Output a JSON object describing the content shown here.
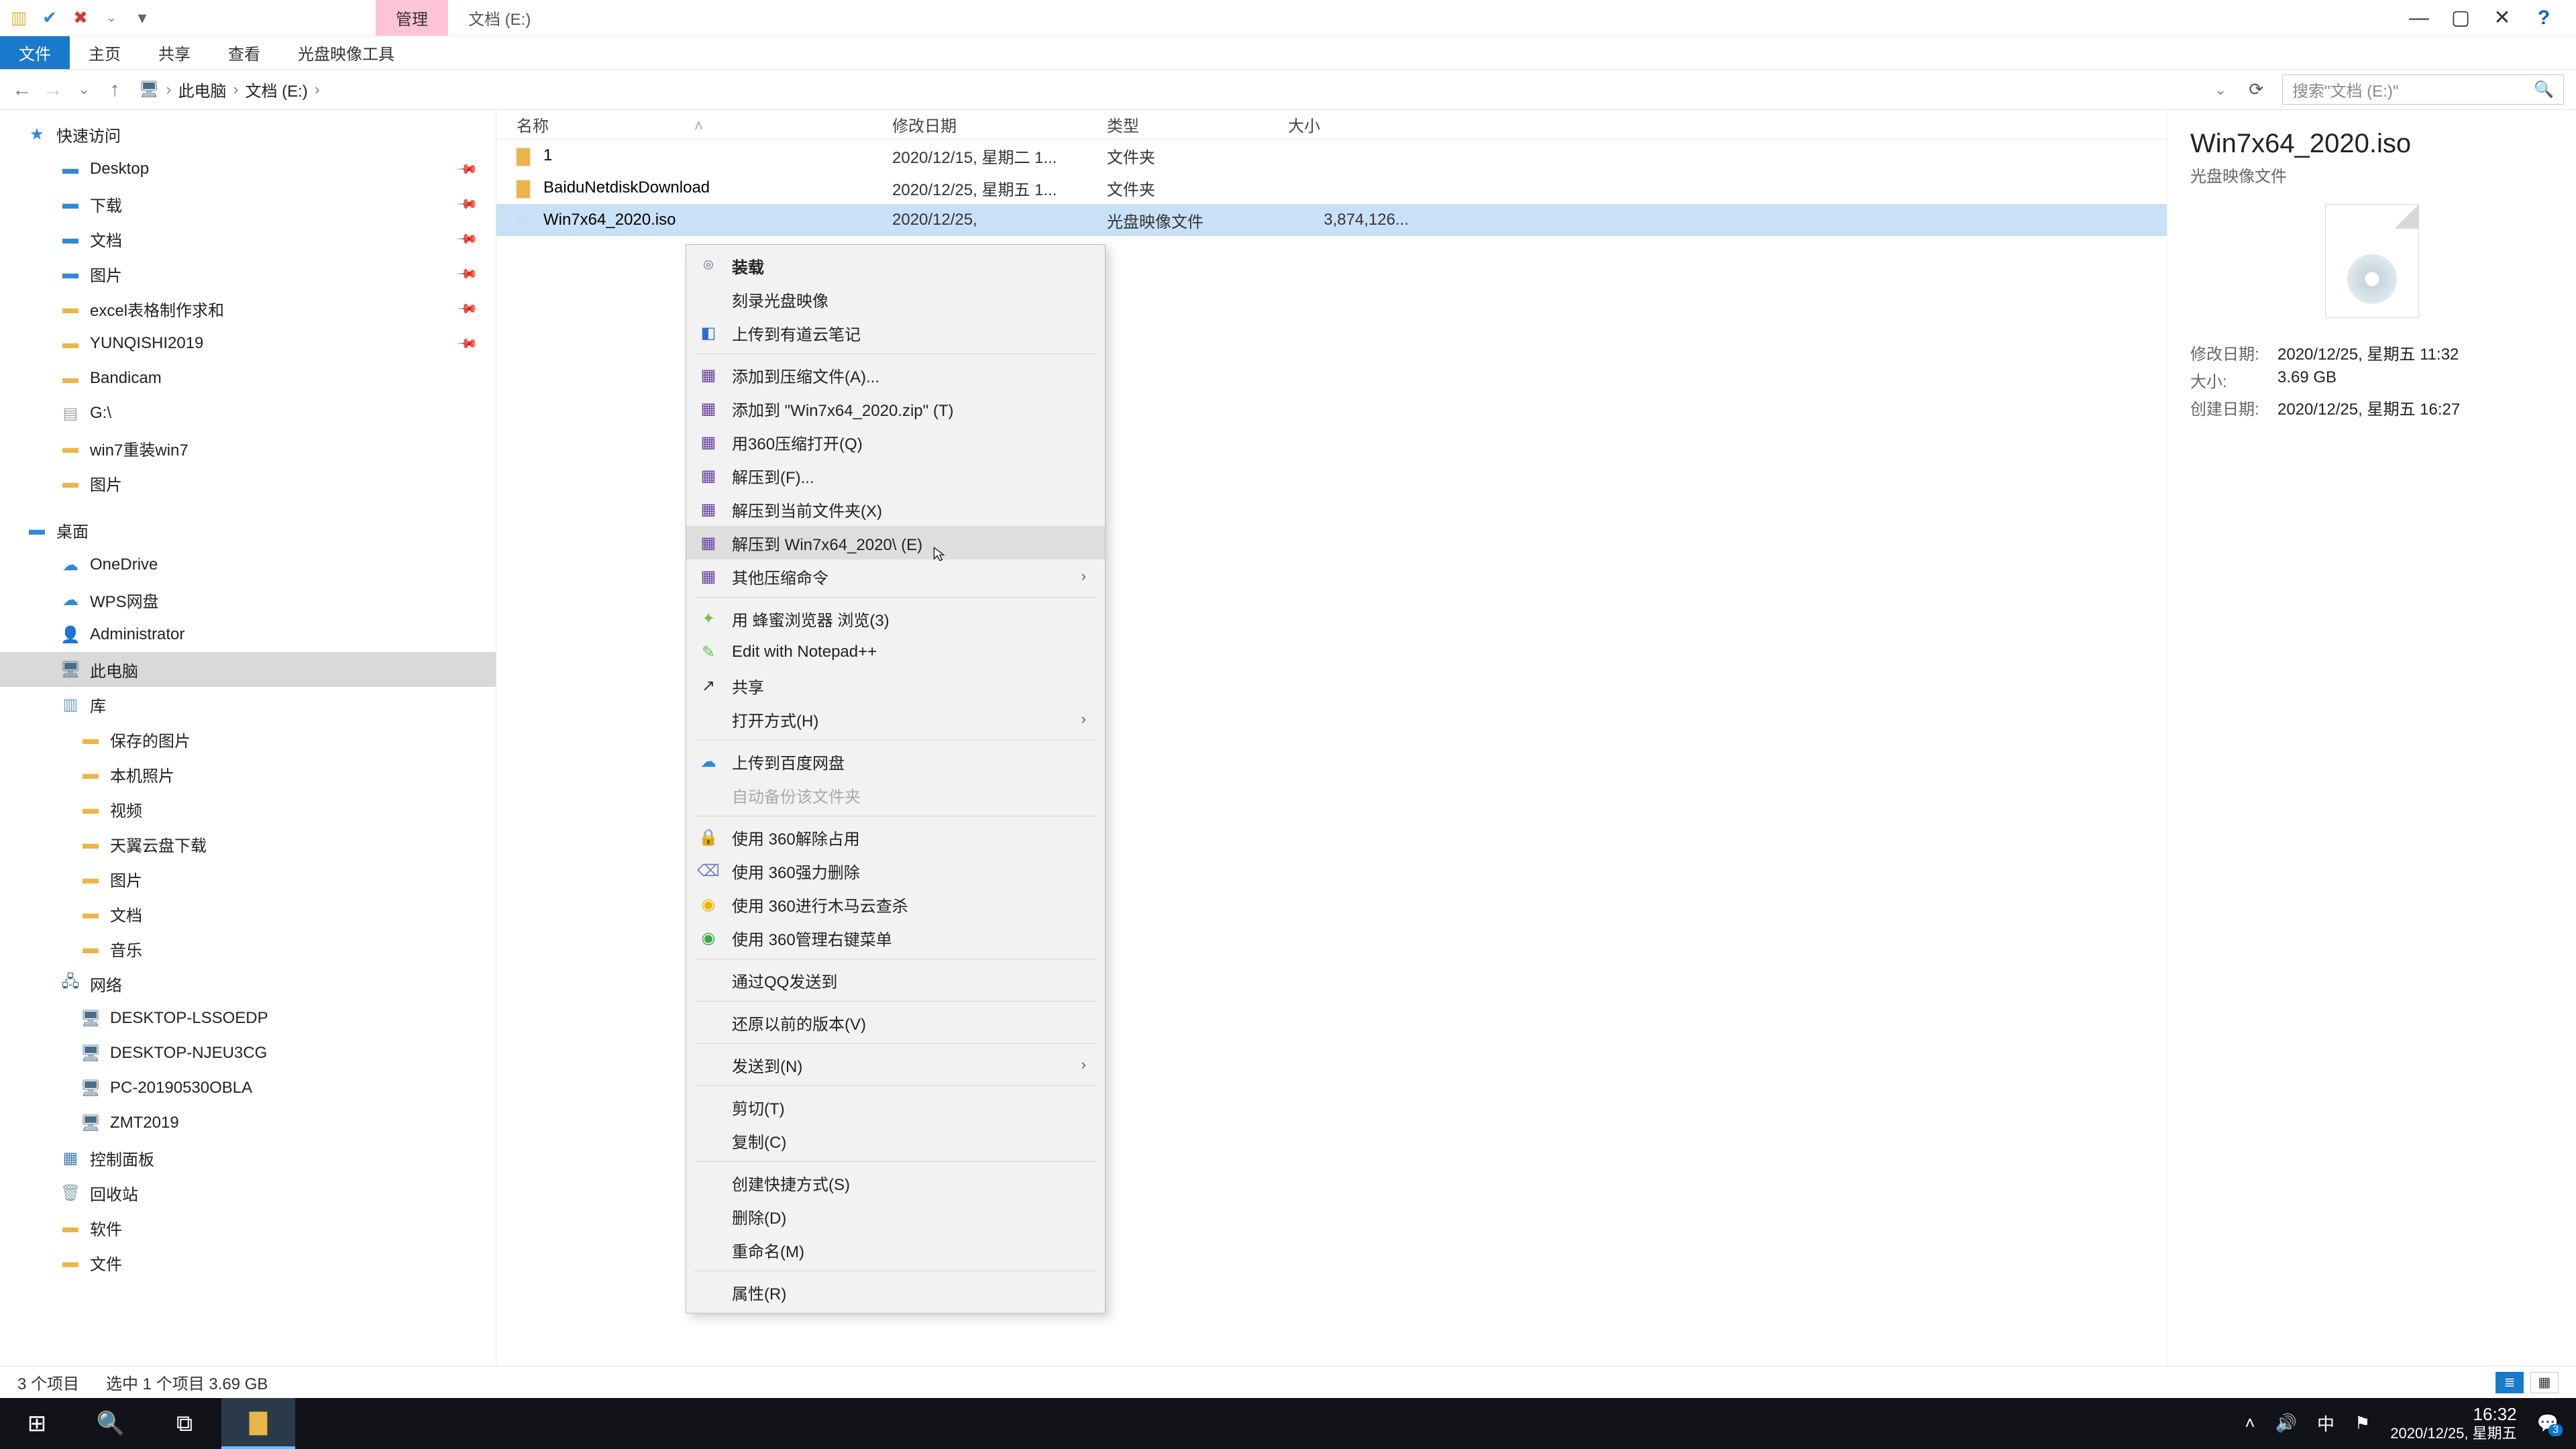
{
  "window": {
    "tab_manage": "管理",
    "tab_title": "文档 (E:)"
  },
  "ribbon": {
    "file": "文件",
    "home": "主页",
    "share": "共享",
    "view": "查看",
    "iso": "光盘映像工具"
  },
  "breadcrumb": {
    "pc": "此电脑",
    "loc": "文档 (E:)"
  },
  "search": {
    "placeholder": "搜索\"文档 (E:)\""
  },
  "columns": {
    "name": "名称",
    "date": "修改日期",
    "type": "类型",
    "size": "大小"
  },
  "tree": {
    "quick": "快速访问",
    "desktop": "Desktop",
    "downloads": "下载",
    "documents": "文档",
    "pictures": "图片",
    "excel": "excel表格制作求和",
    "yunqishi": "YUNQISHI2019",
    "bandicam": "Bandicam",
    "gdrive": "G:\\",
    "win7reinstall": "win7重装win7",
    "pictures2": "图片",
    "desk_top": "桌面",
    "onedrive": "OneDrive",
    "wps": "WPS网盘",
    "admin": "Administrator",
    "thispc": "此电脑",
    "libraries": "库",
    "saved_pics": "保存的图片",
    "local_pics": "本机照片",
    "videos": "视频",
    "tianyi": "天翼云盘下载",
    "lib_pics": "图片",
    "lib_docs": "文档",
    "lib_music": "音乐",
    "network": "网络",
    "net1": "DESKTOP-LSSOEDP",
    "net2": "DESKTOP-NJEU3CG",
    "net3": "PC-20190530OBLA",
    "net4": "ZMT2019",
    "ctrl_panel": "控制面板",
    "recycle": "回收站",
    "software": "软件",
    "files": "文件"
  },
  "files": {
    "r0": {
      "name": "1",
      "date": "2020/12/15, 星期二 1...",
      "type": "文件夹",
      "size": ""
    },
    "r1": {
      "name": "BaiduNetdiskDownload",
      "date": "2020/12/25, 星期五 1...",
      "type": "文件夹",
      "size": ""
    },
    "r2": {
      "name": "Win7x64_2020.iso",
      "date": "2020/12/25,",
      "type": "光盘映像文件",
      "size": "3,874,126..."
    }
  },
  "ctx": {
    "mount": "装载",
    "burn": "刻录光盘映像",
    "youdao": "上传到有道云笔记",
    "add_archive": "添加到压缩文件(A)...",
    "add_zip": "添加到 \"Win7x64_2020.zip\" (T)",
    "open_360zip": "用360压缩打开(Q)",
    "extract_to": "解压到(F)...",
    "extract_here": "解压到当前文件夹(X)",
    "extract_named": "解压到 Win7x64_2020\\ (E)",
    "other_zip": "其他压缩命令",
    "bee_browser": "用 蜂蜜浏览器 浏览(3)",
    "notepadpp": "Edit with Notepad++",
    "share": "共享",
    "open_with": "打开方式(H)",
    "baidu_upload": "上传到百度网盘",
    "auto_backup": "自动备份该文件夹",
    "unlock_360": "使用 360解除占用",
    "force_del_360": "使用 360强力删除",
    "trojan_360": "使用 360进行木马云查杀",
    "manage_ctx_360": "使用 360管理右键菜单",
    "qq_send": "通过QQ发送到",
    "restore_prev": "还原以前的版本(V)",
    "send_to": "发送到(N)",
    "cut": "剪切(T)",
    "copy": "复制(C)",
    "shortcut": "创建快捷方式(S)",
    "delete": "删除(D)",
    "rename": "重命名(M)",
    "properties": "属性(R)"
  },
  "details": {
    "title": "Win7x64_2020.iso",
    "subtitle": "光盘映像文件",
    "mod_k": "修改日期:",
    "mod_v": "2020/12/25, 星期五 11:32",
    "size_k": "大小:",
    "size_v": "3.69 GB",
    "created_k": "创建日期:",
    "created_v": "2020/12/25, 星期五 16:27"
  },
  "status": {
    "count": "3 个项目",
    "sel": "选中 1 个项目  3.69 GB"
  },
  "taskbar": {
    "ime": "中",
    "time": "16:32",
    "date": "2020/12/25, 星期五",
    "notif_count": "3"
  }
}
